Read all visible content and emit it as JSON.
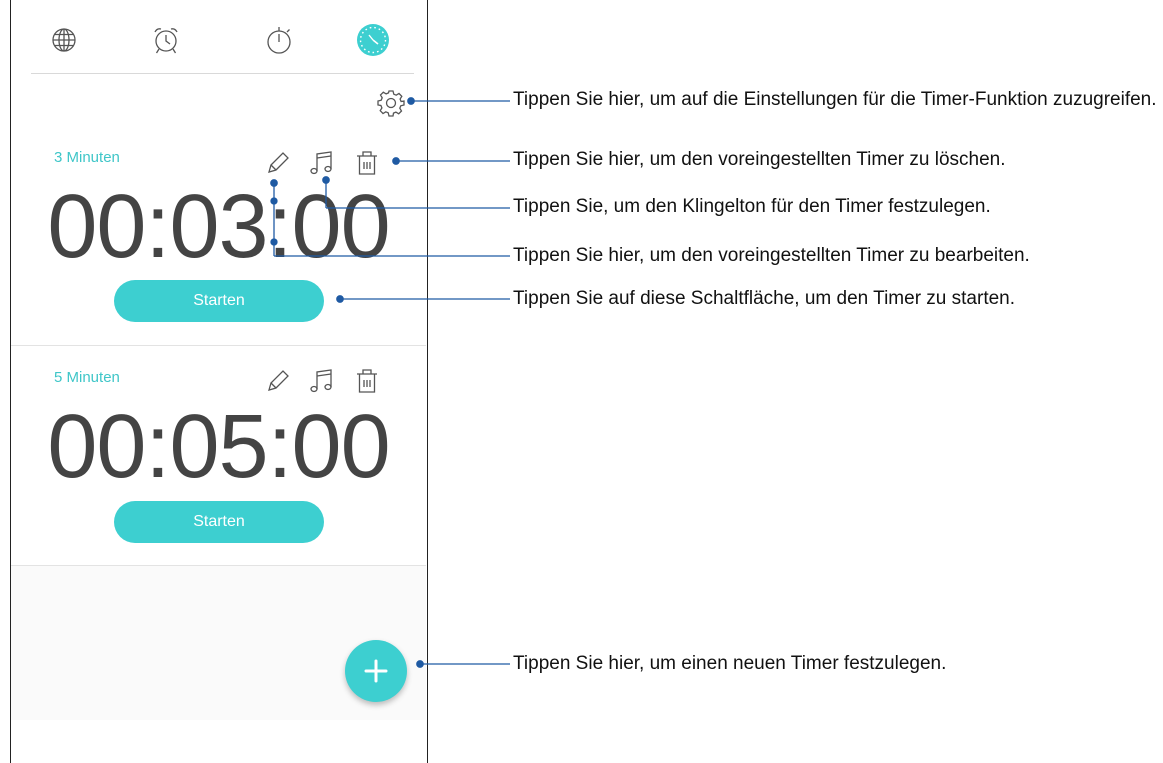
{
  "tabs": [
    {
      "name": "world-clock",
      "icon": "globe-icon"
    },
    {
      "name": "alarm",
      "icon": "alarm-clock-icon"
    },
    {
      "name": "stopwatch",
      "icon": "stopwatch-icon"
    },
    {
      "name": "timer",
      "icon": "timer-icon",
      "active": true
    }
  ],
  "timers": [
    {
      "label": "3 Minuten",
      "time": "00:03:00",
      "start_label": "Starten"
    },
    {
      "label": "5 Minuten",
      "time": "00:05:00",
      "start_label": "Starten"
    }
  ],
  "callouts": {
    "settings": "Tippen Sie hier, um auf die Einstellungen für die Timer-Funktion zuzugreifen.",
    "delete": "Tippen Sie hier, um den voreingestellten Timer zu löschen.",
    "ringtone": "Tippen Sie, um den Klingelton für den Timer festzulegen.",
    "edit": "Tippen Sie hier, um den voreingestellten Timer zu bearbeiten.",
    "start": "Tippen Sie auf diese Schaltfläche, um den Timer zu starten.",
    "add": "Tippen Sie hier, um einen neuen Timer festzulegen."
  },
  "colors": {
    "accent": "#3dcfd0",
    "accent_text": "#3fc6c8",
    "callout_line": "#1f5aa3"
  }
}
